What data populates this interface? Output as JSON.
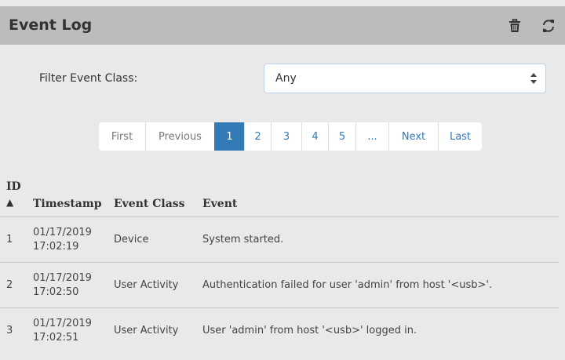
{
  "header": {
    "title": "Event Log",
    "icons": [
      "trash-icon",
      "refresh-icon"
    ]
  },
  "filter": {
    "label": "Filter Event Class:",
    "selected": "Any"
  },
  "pagination": {
    "first": "First",
    "previous": "Previous",
    "pages": [
      "1",
      "2",
      "3",
      "4",
      "5",
      "..."
    ],
    "next": "Next",
    "last": "Last",
    "active_page": "1"
  },
  "table": {
    "headers": {
      "id": "ID",
      "sort_indicator": "▲",
      "timestamp": "Timestamp",
      "event_class": "Event Class",
      "event": "Event"
    },
    "rows": [
      {
        "id": "1",
        "date": "01/17/2019",
        "time": "17:02:19",
        "event_class": "Device",
        "event": "System started."
      },
      {
        "id": "2",
        "date": "01/17/2019",
        "time": "17:02:50",
        "event_class": "User Activity",
        "event": "Authentication failed for user 'admin' from host '<usb>'."
      },
      {
        "id": "3",
        "date": "01/17/2019",
        "time": "17:02:51",
        "event_class": "User Activity",
        "event": "User 'admin' from host '<usb>' logged in."
      }
    ]
  },
  "colors": {
    "header_bg": "#bcbcbc",
    "panel_bg": "#e9e9e9",
    "accent": "#337ab7"
  }
}
